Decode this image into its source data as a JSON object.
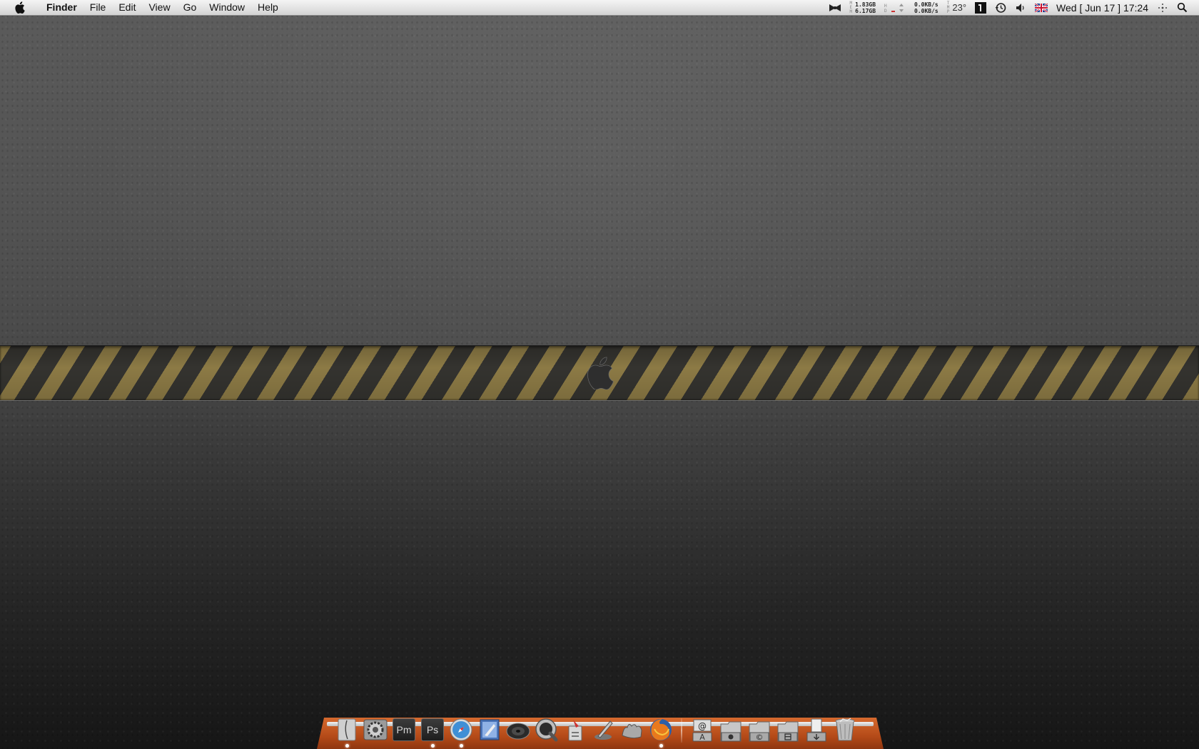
{
  "menubar": {
    "app_name": "Finder",
    "items": [
      "File",
      "Edit",
      "View",
      "Go",
      "Window",
      "Help"
    ],
    "status": {
      "memory_top": "1.83GB",
      "memory_bottom": "6.17GB",
      "net_up": "0.0KB/s",
      "net_down": "0.0KB/s",
      "temperature": "23°",
      "clock": "Wed  [ Jun 17 ] 17:24"
    }
  },
  "dock": {
    "app_icons": [
      {
        "name": "finder-app-icon"
      },
      {
        "name": "system-preferences-icon"
      },
      {
        "name": "photoshop-elements-icon",
        "label": "Pm"
      },
      {
        "name": "photoshop-icon",
        "label": "Ps"
      },
      {
        "name": "safari-icon"
      },
      {
        "name": "mail-icon"
      },
      {
        "name": "speaker-app-icon"
      },
      {
        "name": "quicktime-icon"
      },
      {
        "name": "script-editor-icon"
      },
      {
        "name": "ink-pen-icon"
      },
      {
        "name": "hand-tool-icon"
      },
      {
        "name": "firefox-icon"
      }
    ],
    "stack_icons": [
      {
        "name": "email-stack-icon",
        "glyph": "@"
      },
      {
        "name": "applications-folder-icon",
        "glyph": "A"
      },
      {
        "name": "apple-folder-icon",
        "glyph": ""
      },
      {
        "name": "copyright-folder-icon",
        "glyph": "©"
      },
      {
        "name": "documents-folder-icon",
        "glyph": "▤"
      },
      {
        "name": "downloads-folder-icon",
        "glyph": "⬇"
      },
      {
        "name": "trash-icon"
      }
    ]
  },
  "colors": {
    "stripe_yellow": "#8c7a45",
    "stripe_dark": "#34332f",
    "dock_shelf": "#b44a18"
  }
}
